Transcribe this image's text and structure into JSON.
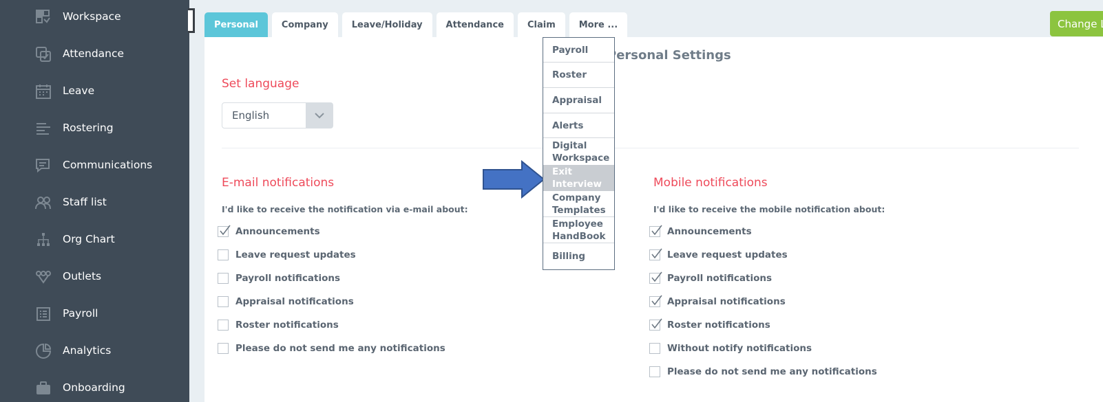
{
  "sidebar": {
    "items": [
      {
        "label": "Workspace",
        "icon": "workspace-icon"
      },
      {
        "label": "Attendance",
        "icon": "attendance-icon"
      },
      {
        "label": "Leave",
        "icon": "calendar-icon"
      },
      {
        "label": "Rostering",
        "icon": "rostering-icon"
      },
      {
        "label": "Communications",
        "icon": "chat-icon"
      },
      {
        "label": "Staff list",
        "icon": "staff-icon"
      },
      {
        "label": "Org Chart",
        "icon": "org-chart-icon"
      },
      {
        "label": "Outlets",
        "icon": "outlets-icon"
      },
      {
        "label": "Payroll",
        "icon": "payroll-icon"
      },
      {
        "label": "Analytics",
        "icon": "analytics-icon"
      },
      {
        "label": "Onboarding",
        "icon": "briefcase-icon"
      }
    ]
  },
  "tabs": [
    {
      "label": "Personal",
      "active": true
    },
    {
      "label": "Company",
      "active": false
    },
    {
      "label": "Leave/Holiday",
      "active": false
    },
    {
      "label": "Attendance",
      "active": false
    },
    {
      "label": "Claim",
      "active": false
    },
    {
      "label": "More ...",
      "active": false
    }
  ],
  "header": {
    "change_button": "Change Lo"
  },
  "main": {
    "page_title": "Personal Settings",
    "language": {
      "title": "Set language",
      "selected": "English"
    },
    "email": {
      "title": "E-mail notifications",
      "description": "I'd like to receive the notification via e-mail about:",
      "options": [
        {
          "label": "Announcements",
          "checked": true
        },
        {
          "label": "Leave request updates",
          "checked": false
        },
        {
          "label": "Payroll notifications",
          "checked": false
        },
        {
          "label": "Appraisal notifications",
          "checked": false
        },
        {
          "label": "Roster notifications",
          "checked": false
        },
        {
          "label": "Please do not send me any notifications",
          "checked": false
        }
      ]
    },
    "mobile": {
      "title": "Mobile notifications",
      "description": "I'd like to receive the mobile notification about:",
      "options": [
        {
          "label": "Announcements",
          "checked": true
        },
        {
          "label": "Leave request updates",
          "checked": true
        },
        {
          "label": "Payroll notifications",
          "checked": true
        },
        {
          "label": "Appraisal notifications",
          "checked": true
        },
        {
          "label": "Roster notifications",
          "checked": true
        },
        {
          "label": "Without notify notifications",
          "checked": false
        },
        {
          "label": "Please do not send me any notifications",
          "checked": false
        }
      ]
    }
  },
  "more_menu": {
    "items": [
      {
        "line1": "Payroll",
        "line2": ""
      },
      {
        "line1": "Roster",
        "line2": ""
      },
      {
        "line1": "Appraisal",
        "line2": ""
      },
      {
        "line1": "Alerts",
        "line2": ""
      },
      {
        "line1": "Digital",
        "line2": "Workspace"
      },
      {
        "line1": "Exit",
        "line2": "Interview",
        "highlighted": true
      },
      {
        "line1": "Company",
        "line2": "Templates"
      },
      {
        "line1": "Employee",
        "line2": "HandBook"
      },
      {
        "line1": "Billing",
        "line2": ""
      }
    ]
  },
  "colors": {
    "sidebar_bg": "#3f4b57",
    "accent_tab": "#5cc6d9",
    "section_title": "#ee4a5a",
    "change_button": "#8cc43f",
    "arrow": "#4472c4"
  }
}
